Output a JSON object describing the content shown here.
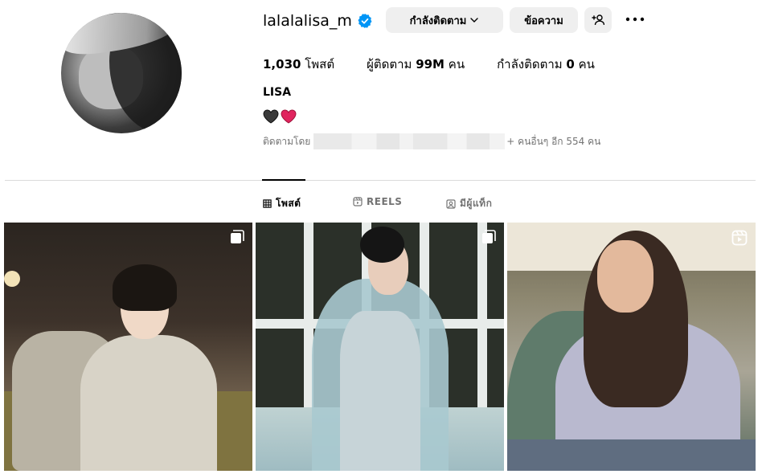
{
  "profile": {
    "username": "lalalalisa_m",
    "verified": true,
    "full_name": "LISA",
    "bio_emoji": [
      "black-heart",
      "red-heart"
    ]
  },
  "actions": {
    "following_label": "กำลังติดตาม",
    "message_label": "ข้อความ",
    "add_user_icon": "person-add-icon",
    "more_icon": "more-horizontal-icon"
  },
  "stats": {
    "posts_count": "1,030",
    "posts_label": "โพสต์",
    "followers_label": "ผู้ติดตาม",
    "followers_count": "99M",
    "followers_unit": "คน",
    "following_label": "กำลังติดตาม",
    "following_count": "0",
    "following_unit": "คน"
  },
  "followed_by": {
    "prefix": "ติดตามโดย",
    "suffix": "+ คนอื่นๆ อีก 554 คน"
  },
  "tabs": [
    {
      "label": "โพสต์",
      "icon": "grid-icon",
      "active": true
    },
    {
      "label": "REELS",
      "icon": "reels-icon",
      "active": false
    },
    {
      "label": "มีผู้แท็ก",
      "icon": "tagged-icon",
      "active": false
    }
  ],
  "posts": [
    {
      "type": "carousel",
      "icon": "carousel-icon"
    },
    {
      "type": "carousel",
      "icon": "carousel-icon"
    },
    {
      "type": "reel",
      "icon": "reel-icon"
    }
  ],
  "colors": {
    "verified": "#0095f6",
    "button_bg": "#efefef",
    "secondary_text": "#737373",
    "divider": "#dbdbdb",
    "heart_red": "#e0245e",
    "heart_black": "#3a3a3a"
  }
}
